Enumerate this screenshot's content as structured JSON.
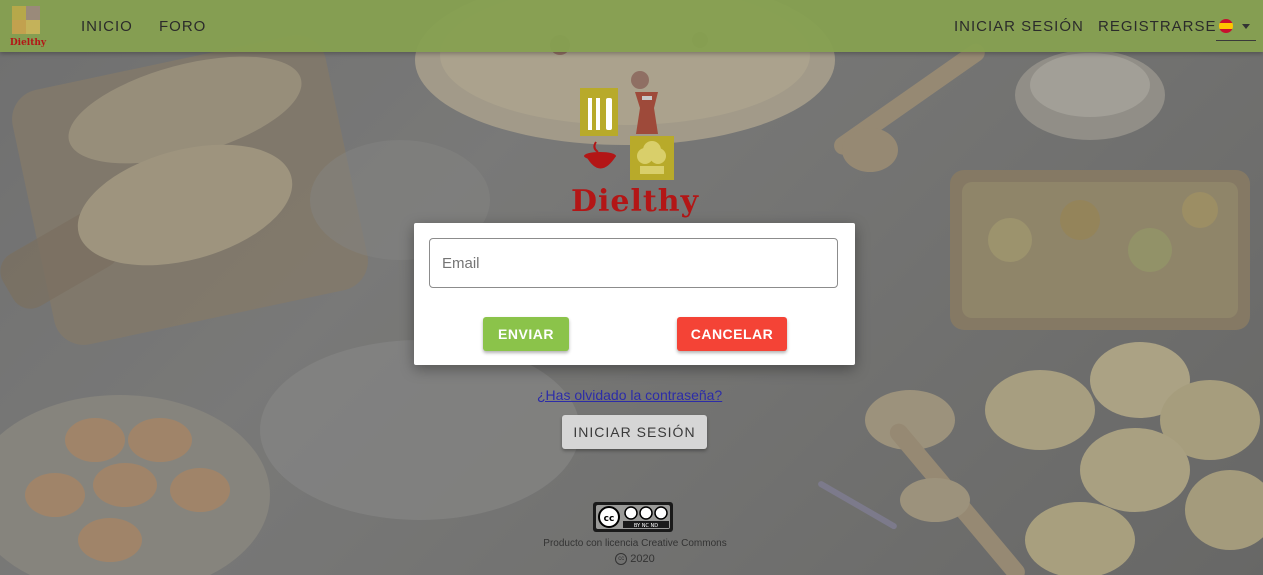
{
  "navbar": {
    "logo_text": "Dielthy",
    "links": [
      {
        "label": "INICIO"
      },
      {
        "label": "FORO"
      }
    ],
    "right_links": [
      {
        "label": "INICIAR SESIÓN"
      },
      {
        "label": "REGISTRARSE"
      }
    ],
    "language_flag": "spain-flag"
  },
  "brand": {
    "name": "Dielthy",
    "color": "#b31616"
  },
  "modal": {
    "email_placeholder": "Email",
    "email_value": "",
    "send_label": "ENVIAR",
    "cancel_label": "CANCELAR"
  },
  "auth": {
    "forgot_password": "¿Has olvidado la contraseña?",
    "login_label": "INICIAR SESIÓN"
  },
  "footer": {
    "cc_badge_text": "BY NC ND",
    "license_text": "Producto con licencia Creative Commons",
    "copyright_symbol": "cc",
    "year": "2020"
  },
  "colors": {
    "navbar": "#86a050",
    "send_button": "#8bc34a",
    "cancel_button": "#f44336",
    "link": "#2c2ca8"
  }
}
